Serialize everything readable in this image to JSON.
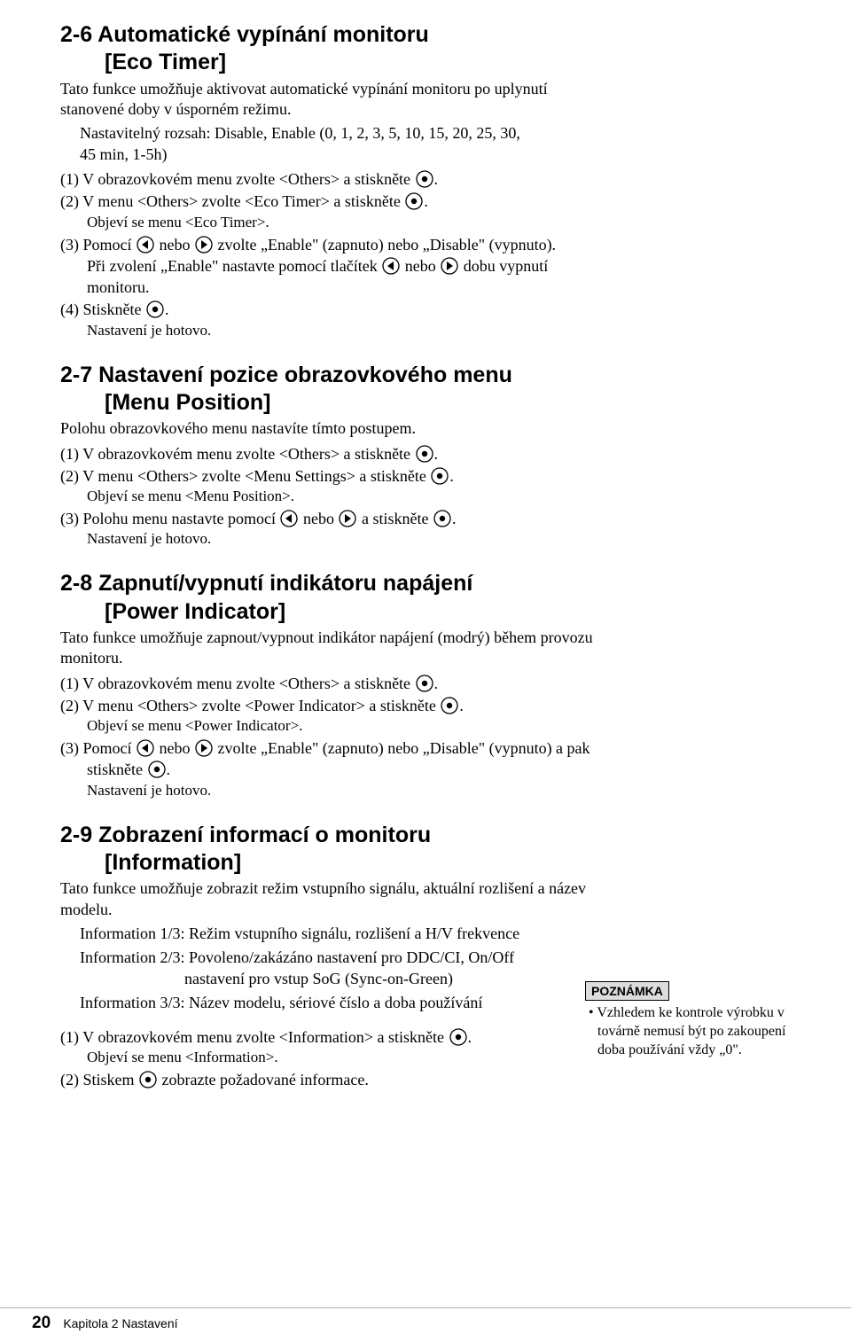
{
  "s26": {
    "title_line1": "2-6 Automatické vypínání monitoru",
    "title_line2": "[Eco Timer]",
    "p1": "Tato funkce umožňuje aktivovat automatické vypínání monitoru po uplynutí stanovené doby v úsporném režimu.",
    "p2a": "Nastavitelný rozsah: Disable, Enable (0, 1, 2, 3, 5, 10, 15, 20, 25, 30,",
    "p2b": "45 min, 1-5h)",
    "step1a": "(1) V obrazovkovém menu zvolte <Others> a stiskněte ",
    "step1b": ".",
    "step2a": "(2) V menu <Others> zvolte <Eco Timer> a stiskněte ",
    "step2b": ".",
    "step2note": "Objeví se menu <Eco Timer>.",
    "step3a": "(3) Pomocí ",
    "step3b": " nebo ",
    "step3c": " zvolte „Enable\" (zapnuto) nebo „Disable\" (vypnuto).",
    "step3d": "Při zvolení „Enable\" nastavte pomocí tlačítek ",
    "step3e": " nebo ",
    "step3f": " dobu vypnutí monitoru.",
    "step4a": "(4) Stiskněte ",
    "step4b": ".",
    "step4note": "Nastavení je hotovo."
  },
  "s27": {
    "title_line1": "2-7 Nastavení pozice obrazovkového menu",
    "title_line2": "[Menu Position]",
    "p1": "Polohu obrazovkového menu nastavíte tímto postupem.",
    "step1a": "(1) V obrazovkovém menu zvolte <Others> a stiskněte ",
    "step1b": ".",
    "step2a": "(2) V menu <Others> zvolte <Menu Settings> a stiskněte ",
    "step2b": ".",
    "step2note": "Objeví se menu <Menu Position>.",
    "step3a": "(3) Polohu menu nastavte pomocí ",
    "step3b": " nebo ",
    "step3c": " a stiskněte ",
    "step3d": ".",
    "step3note": "Nastavení je hotovo."
  },
  "s28": {
    "title_line1": "2-8 Zapnutí/vypnutí indikátoru napájení",
    "title_line2": "[Power Indicator]",
    "p1": "Tato funkce umožňuje zapnout/vypnout indikátor napájení (modrý) během provozu monitoru.",
    "step1a": "(1) V obrazovkovém menu zvolte <Others> a stiskněte ",
    "step1b": ".",
    "step2a": "(2) V menu <Others> zvolte <Power Indicator> a stiskněte ",
    "step2b": ".",
    "step2note": "Objeví se menu <Power Indicator>.",
    "step3a": "(3) Pomocí ",
    "step3b": " nebo ",
    "step3c": " zvolte „Enable\" (zapnuto) nebo „Disable\" (vypnuto) a pak stiskněte ",
    "step3d": ".",
    "step3note": "Nastavení je hotovo."
  },
  "s29": {
    "title_line1": "2-9 Zobrazení informací o monitoru",
    "title_line2": "[Information]",
    "p1": "Tato funkce umožňuje zobrazit režim vstupního signálu, aktuální rozlišení a název modelu.",
    "info1": "Information 1/3: Režim vstupního signálu, rozlišení a H/V frekvence",
    "info2a": "Information 2/3: Povoleno/zakázáno nastavení pro DDC/CI, On/Off",
    "info2b": "nastavení pro vstup SoG (Sync-on-Green)",
    "info3": "Information 3/3: Název modelu, sériové číslo a doba používání",
    "step1a": "(1) V obrazovkovém menu zvolte <Information> a stiskněte ",
    "step1b": ".",
    "step1note": "Objeví se menu <Information>.",
    "step2a": "(2) Stiskem ",
    "step2b": " zobrazte požadované informace."
  },
  "note": {
    "label": "POZNÁMKA",
    "body": "• Vzhledem ke kontrole výrobku v továrně nemusí být po zakoupení doba používání vždy „0\"."
  },
  "footer": {
    "page_no": "20",
    "chapter": "Kapitola 2 Nastavení"
  }
}
